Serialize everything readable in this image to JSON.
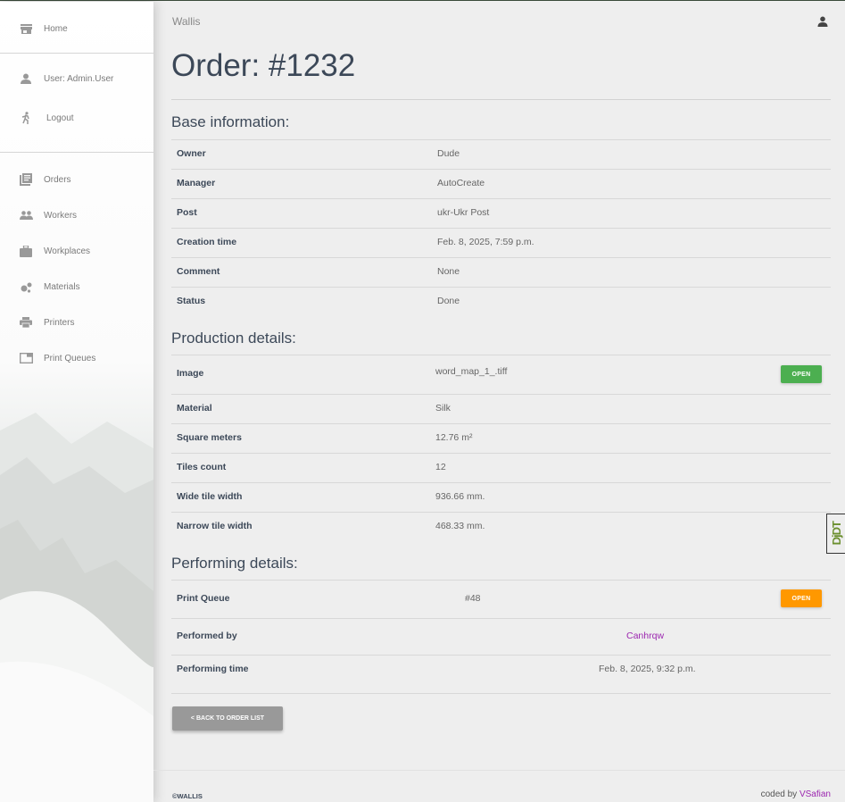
{
  "sidebar": {
    "home": "Home",
    "user": "User: Admin.User",
    "logout": "Logout",
    "items": [
      {
        "label": "Orders",
        "icon": "library-books-icon"
      },
      {
        "label": "Workers",
        "icon": "people-icon"
      },
      {
        "label": "Workplaces",
        "icon": "briefcase-icon"
      },
      {
        "label": "Materials",
        "icon": "bubble-chart-icon"
      },
      {
        "label": "Printers",
        "icon": "printer-icon"
      },
      {
        "label": "Print Queues",
        "icon": "queue-icon"
      }
    ]
  },
  "header": {
    "brand": "Wallis",
    "title": "Order: #1232"
  },
  "base": {
    "heading": "Base information:",
    "rows": [
      {
        "label": "Owner",
        "value": "Dude"
      },
      {
        "label": "Manager",
        "value": "AutoCreate"
      },
      {
        "label": "Post",
        "value": "ukr-Ukr Post"
      },
      {
        "label": "Creation time",
        "value": "Feb. 8, 2025, 7:59 p.m."
      },
      {
        "label": "Comment",
        "value": "None"
      },
      {
        "label": "Status",
        "value": "Done"
      }
    ]
  },
  "production": {
    "heading": "Production details:",
    "rows": [
      {
        "label": "Image",
        "value": "word_map_1_.tiff",
        "button": "OPEN"
      },
      {
        "label": "Material",
        "value": "Silk"
      },
      {
        "label": "Square meters",
        "value": "12.76 m²"
      },
      {
        "label": "Tiles count",
        "value": "12"
      },
      {
        "label": "Wide tile width",
        "value": "936.66 mm."
      },
      {
        "label": "Narrow tile width",
        "value": "468.33 mm."
      }
    ]
  },
  "performing": {
    "heading": "Performing details:",
    "rows": [
      {
        "label": "Print Queue",
        "value": "#48",
        "button": "OPEN"
      },
      {
        "label": "Performed by",
        "value": "Canhrqw"
      },
      {
        "label": "Performing time",
        "value": "Feb. 8, 2025, 9:32 p.m."
      }
    ]
  },
  "back_button": "< BACK TO ORDER LIST",
  "footer": {
    "copyright": "©WALLIS",
    "coded_by": "coded by",
    "author": "VSafian"
  },
  "debug_toolbar": "DjDT",
  "colors": {
    "open_image": "#4caf50",
    "open_queue": "#ff9800",
    "link": "#9c27b0"
  }
}
